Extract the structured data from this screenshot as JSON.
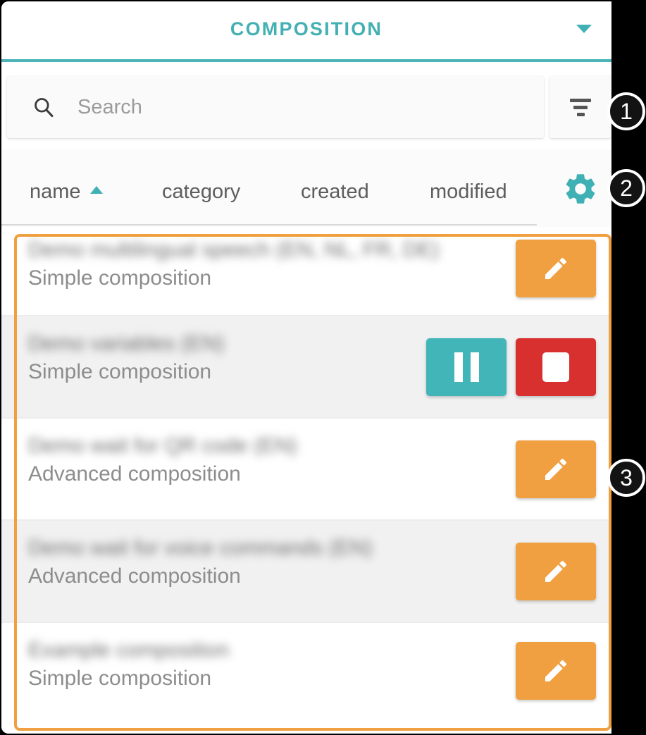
{
  "window": {
    "title": "COMPOSITION",
    "dropdown_icon": "chevron-down-icon",
    "accent_color": "#43b0b3"
  },
  "search": {
    "placeholder": "Search",
    "value": "",
    "icon": "search-icon",
    "filter_icon": "filter-icon"
  },
  "columns": {
    "name": "name",
    "category": "category",
    "created": "created",
    "modified": "modified",
    "sort_field": "name",
    "sort_direction": "ascending",
    "sort_icon": "caret-up-icon",
    "settings_icon": "gear-icon",
    "settings_color": "#3fb0b4"
  },
  "list": {
    "rows": [
      {
        "title": "Demo multilingual speech (EN, NL, FR, DE)",
        "subtitle": "Simple composition",
        "redacted": true,
        "shaded": false,
        "actions": [
          {
            "name": "edit-button",
            "icon": "pencil-icon",
            "color": "#f0a040"
          }
        ]
      },
      {
        "title": "Demo variables (EN)",
        "subtitle": "Simple composition",
        "redacted": true,
        "shaded": true,
        "actions": [
          {
            "name": "pause-button",
            "icon": "pause-icon",
            "color": "#41b5b8"
          },
          {
            "name": "stop-button",
            "icon": "stop-icon",
            "color": "#d8302f"
          }
        ]
      },
      {
        "title": "Demo wait for QR code (EN)",
        "subtitle": "Advanced composition",
        "redacted": true,
        "shaded": false,
        "actions": [
          {
            "name": "edit-button",
            "icon": "pencil-icon",
            "color": "#f0a040"
          }
        ]
      },
      {
        "title": "Demo wait for voice commands (EN)",
        "subtitle": "Advanced composition",
        "redacted": true,
        "shaded": true,
        "actions": [
          {
            "name": "edit-button",
            "icon": "pencil-icon",
            "color": "#f0a040"
          }
        ]
      },
      {
        "title": "Example composition",
        "subtitle": "Simple composition",
        "redacted": true,
        "shaded": false,
        "actions": [
          {
            "name": "edit-button",
            "icon": "pencil-icon",
            "color": "#f0a040"
          }
        ]
      }
    ]
  },
  "annotations": {
    "highlight_color": "#f0a040",
    "badges": [
      {
        "label": "1"
      },
      {
        "label": "2"
      },
      {
        "label": "3"
      }
    ]
  }
}
